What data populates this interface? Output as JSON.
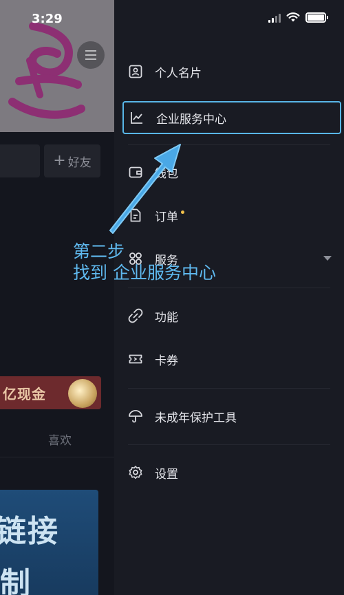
{
  "status_bar": {
    "time": "3:29"
  },
  "left_page": {
    "add_friend_label": "好友",
    "cash_text": "亿现金",
    "tab_like": "喜欢",
    "video_text_line1": "链接",
    "video_text_line2": "制"
  },
  "drawer": {
    "items": [
      {
        "label": "个人名片",
        "icon": "contact-card-icon"
      },
      {
        "label": "企业服务中心",
        "icon": "trend-chart-icon",
        "active": true
      },
      {
        "label": "钱包",
        "icon": "wallet-icon"
      },
      {
        "label": "订单",
        "icon": "order-document-icon",
        "badge": true
      },
      {
        "label": "服务",
        "icon": "services-grid-icon",
        "expandable": true
      },
      {
        "label": "功能",
        "icon": "link-icon"
      },
      {
        "label": "卡券",
        "icon": "coupon-icon"
      },
      {
        "label": "未成年保护工具",
        "icon": "umbrella-icon"
      },
      {
        "label": "设置",
        "icon": "settings-gear-icon"
      }
    ]
  },
  "annotation": {
    "line1": "第二步",
    "line2": "找到 企业服务中心",
    "color": "#5fb9ef"
  },
  "colors": {
    "drawer_bg": "#191b23",
    "highlight_border": "#58b6e8",
    "badge_dot": "#f2c04a"
  }
}
